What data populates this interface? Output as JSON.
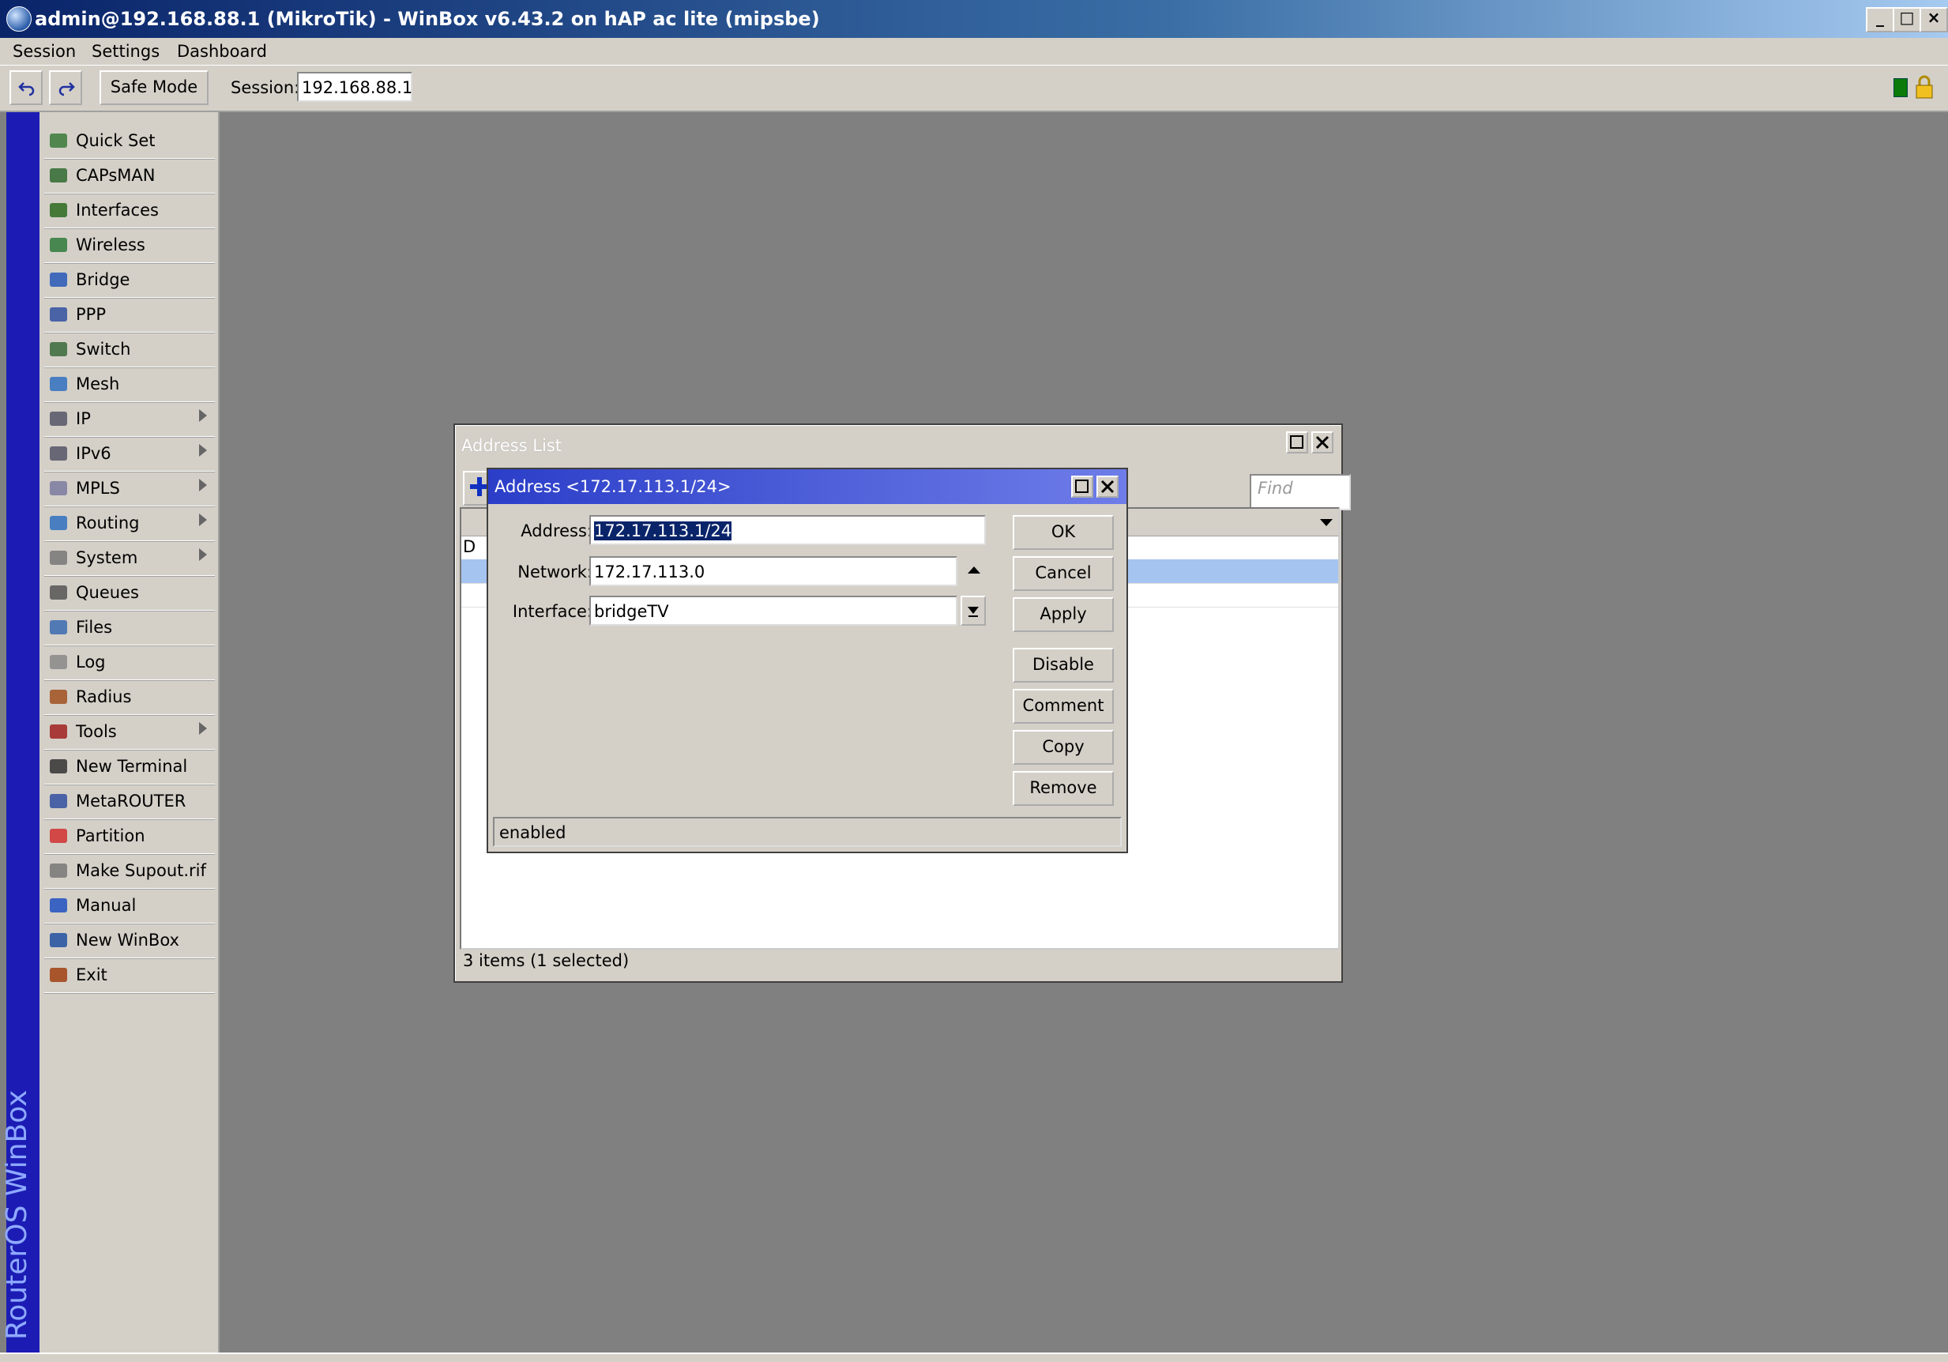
{
  "window": {
    "title": "admin@192.168.88.1 (MikroTik) - WinBox v6.43.2 on hAP ac lite (mipsbe)",
    "controls": [
      "_",
      "□",
      "×"
    ]
  },
  "menu": {
    "items": [
      "Session",
      "Settings",
      "Dashboard"
    ]
  },
  "toolbar": {
    "undo_icon": "undo-icon",
    "redo_icon": "redo-icon",
    "safe_mode_label": "Safe Mode",
    "session_label": "Session:",
    "session_value": "192.168.88.1"
  },
  "brand_vertical": "RouterOS WinBox",
  "sidebar": {
    "items": [
      {
        "label": "Quick Set",
        "icon": "quick-set-icon",
        "submenu": false
      },
      {
        "label": "CAPsMAN",
        "icon": "capsman-icon",
        "submenu": false
      },
      {
        "label": "Interfaces",
        "icon": "interfaces-icon",
        "submenu": false
      },
      {
        "label": "Wireless",
        "icon": "wireless-icon",
        "submenu": false
      },
      {
        "label": "Bridge",
        "icon": "bridge-icon",
        "submenu": false
      },
      {
        "label": "PPP",
        "icon": "ppp-icon",
        "submenu": false
      },
      {
        "label": "Switch",
        "icon": "switch-icon",
        "submenu": false
      },
      {
        "label": "Mesh",
        "icon": "mesh-icon",
        "submenu": false
      },
      {
        "label": "IP",
        "icon": "ip-icon",
        "submenu": true
      },
      {
        "label": "IPv6",
        "icon": "ipv6-icon",
        "submenu": true
      },
      {
        "label": "MPLS",
        "icon": "mpls-icon",
        "submenu": true
      },
      {
        "label": "Routing",
        "icon": "routing-icon",
        "submenu": true
      },
      {
        "label": "System",
        "icon": "system-icon",
        "submenu": true
      },
      {
        "label": "Queues",
        "icon": "queues-icon",
        "submenu": false
      },
      {
        "label": "Files",
        "icon": "files-icon",
        "submenu": false
      },
      {
        "label": "Log",
        "icon": "log-icon",
        "submenu": false
      },
      {
        "label": "Radius",
        "icon": "radius-icon",
        "submenu": false
      },
      {
        "label": "Tools",
        "icon": "tools-icon",
        "submenu": true
      },
      {
        "label": "New Terminal",
        "icon": "terminal-icon",
        "submenu": false
      },
      {
        "label": "MetaROUTER",
        "icon": "metarouter-icon",
        "submenu": false
      },
      {
        "label": "Partition",
        "icon": "partition-icon",
        "submenu": false
      },
      {
        "label": "Make Supout.rif",
        "icon": "supout-icon",
        "submenu": false
      },
      {
        "label": "Manual",
        "icon": "manual-icon",
        "submenu": false
      },
      {
        "label": "New WinBox",
        "icon": "winbox-icon",
        "submenu": false
      },
      {
        "label": "Exit",
        "icon": "exit-icon",
        "submenu": false
      }
    ]
  },
  "address_list": {
    "title": "Address List",
    "find_placeholder": "Find",
    "row_flag": "D",
    "footer": "3 items (1 selected)"
  },
  "address_dialog": {
    "title": "Address <172.17.113.1/24>",
    "address_label": "Address:",
    "address_value": "172.17.113.1/24",
    "network_label": "Network:",
    "network_value": "172.17.113.0",
    "interface_label": "Interface:",
    "interface_value": "bridgeTV",
    "buttons": {
      "ok": "OK",
      "cancel": "Cancel",
      "apply": "Apply",
      "disable": "Disable",
      "comment": "Comment",
      "copy": "Copy",
      "remove": "Remove"
    },
    "status": "enabled"
  },
  "colors": {
    "face": "#d4d0c8",
    "desktop": "#808080",
    "dialog_title": "#2b3ec8",
    "brand_band": "#1c1cb4",
    "selection": "#a6c4f0"
  }
}
